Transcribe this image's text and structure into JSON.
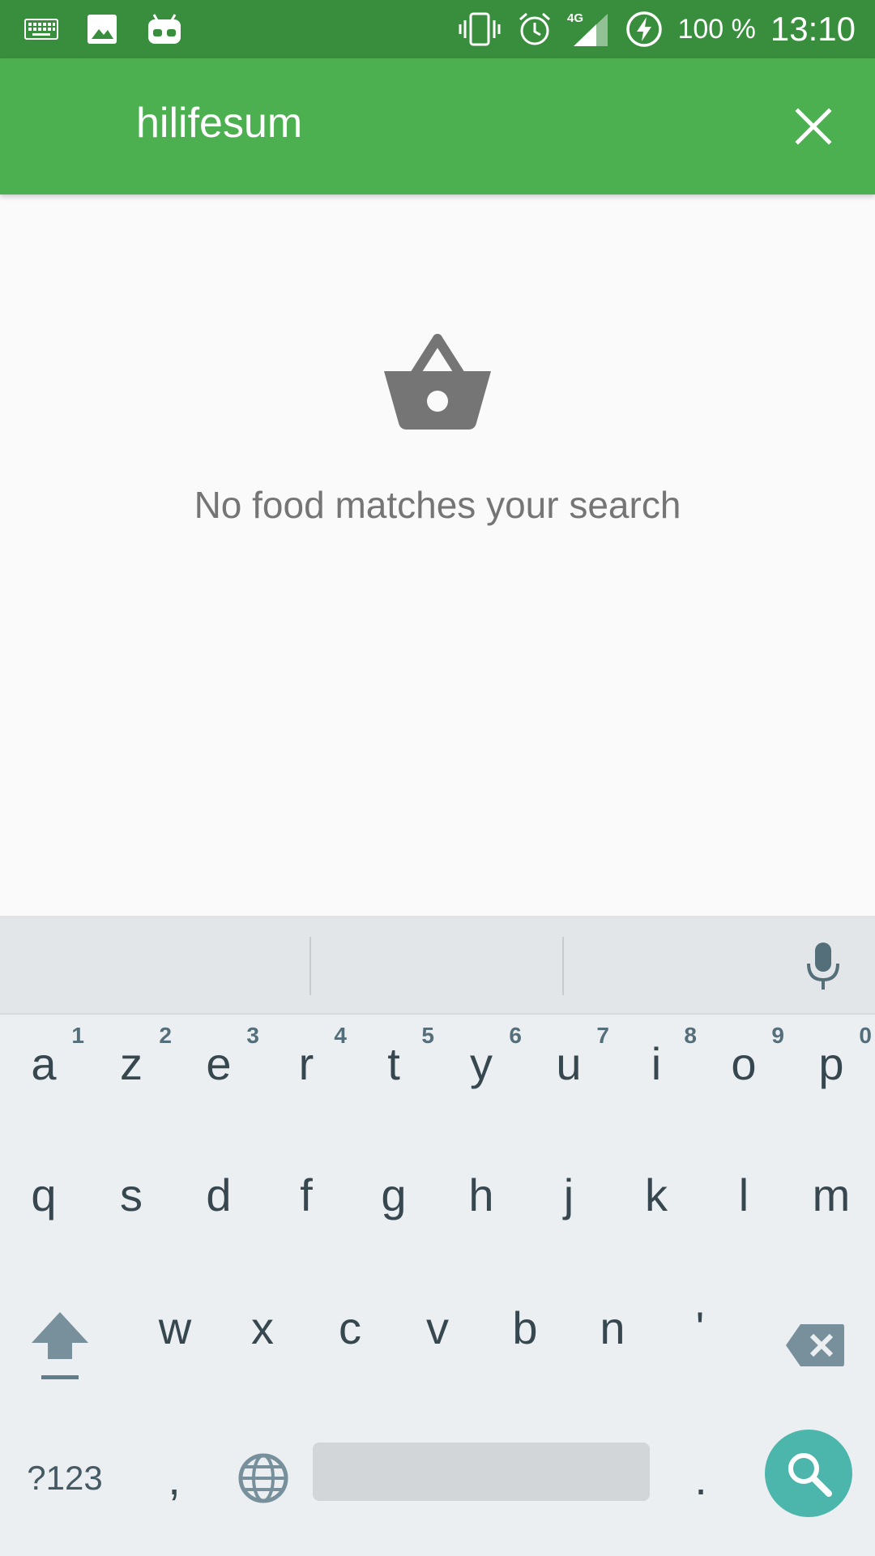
{
  "status_bar": {
    "left_icons": [
      "keyboard-icon",
      "image-icon",
      "android-debug-icon"
    ],
    "right_icons": [
      "vibrate-icon",
      "alarm-icon",
      "signal-4g-icon",
      "battery-charging-icon"
    ],
    "network": "4G",
    "battery": "100 %",
    "time": "13:10"
  },
  "app_bar": {
    "search_value": "hilifesum",
    "close_icon": "close-icon",
    "color": "#4caf50",
    "status_color": "#388e3c"
  },
  "empty_state": {
    "icon": "shopping-basket-icon",
    "message": "No food matches your search"
  },
  "keyboard": {
    "row1": [
      {
        "ch": "a",
        "num": "1"
      },
      {
        "ch": "z",
        "num": "2"
      },
      {
        "ch": "e",
        "num": "3"
      },
      {
        "ch": "r",
        "num": "4"
      },
      {
        "ch": "t",
        "num": "5"
      },
      {
        "ch": "y",
        "num": "6"
      },
      {
        "ch": "u",
        "num": "7"
      },
      {
        "ch": "i",
        "num": "8"
      },
      {
        "ch": "o",
        "num": "9"
      },
      {
        "ch": "p",
        "num": "0"
      }
    ],
    "row2": [
      "q",
      "s",
      "d",
      "f",
      "g",
      "h",
      "j",
      "k",
      "l",
      "m"
    ],
    "row3": [
      "w",
      "x",
      "c",
      "v",
      "b",
      "n",
      "'"
    ],
    "symbols_label": "?123",
    "comma": ",",
    "period": ".",
    "enter_color": "#4db6ac",
    "enter_icon": "search-icon"
  }
}
